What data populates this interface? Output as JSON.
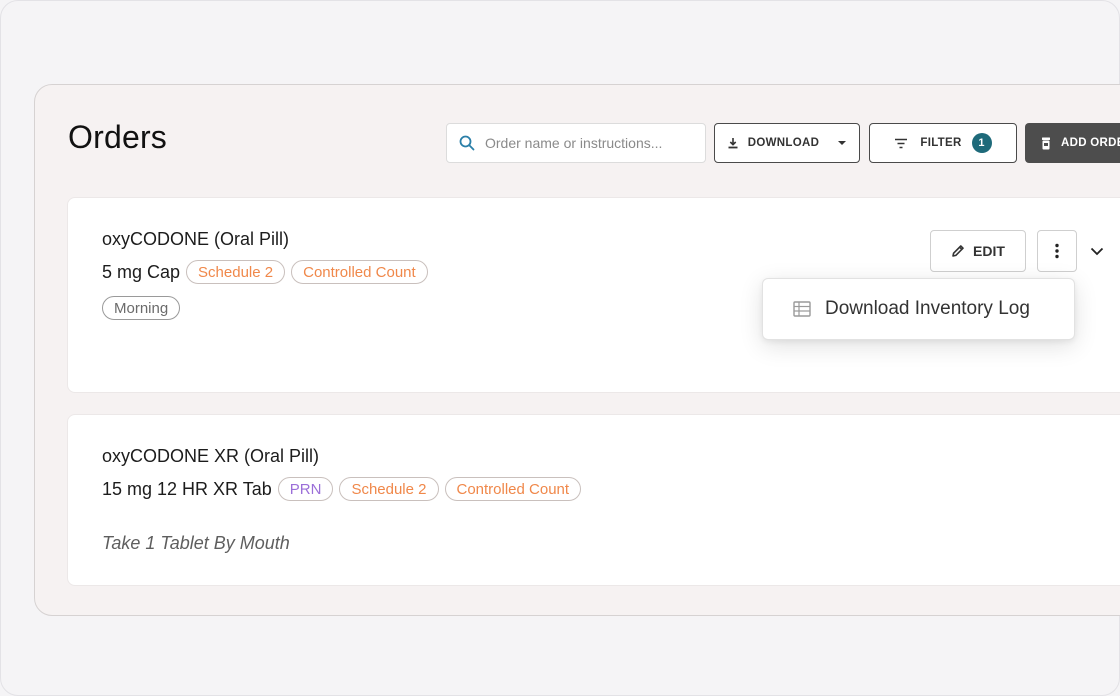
{
  "page": {
    "title": "Orders"
  },
  "toolbar": {
    "search_placeholder": "Order name or instructions...",
    "download_label": "DOWNLOAD",
    "filter_label": "FILTER",
    "filter_count": "1",
    "add_label": "ADD ORDE"
  },
  "orders": [
    {
      "name": "oxyCODONE (Oral Pill)",
      "dose": "5 mg Cap",
      "tags": [
        "Schedule 2",
        "Controlled Count"
      ],
      "time_tag": "Morning",
      "edit_label": "EDIT"
    },
    {
      "name": "oxyCODONE XR (Oral Pill)",
      "dose": "15 mg 12 HR XR Tab",
      "tags": [
        "PRN",
        "Schedule 2",
        "Controlled Count"
      ],
      "instructions": "Take 1 Tablet By Mouth"
    }
  ],
  "menu": {
    "items": [
      {
        "label": "Download Inventory Log",
        "icon": "table-icon"
      }
    ]
  },
  "colors": {
    "accent_orange": "#f0884a",
    "accent_purple": "#9b6fd8",
    "badge_teal": "#1e6a7a",
    "add_button_bg": "#4d4d4d"
  }
}
